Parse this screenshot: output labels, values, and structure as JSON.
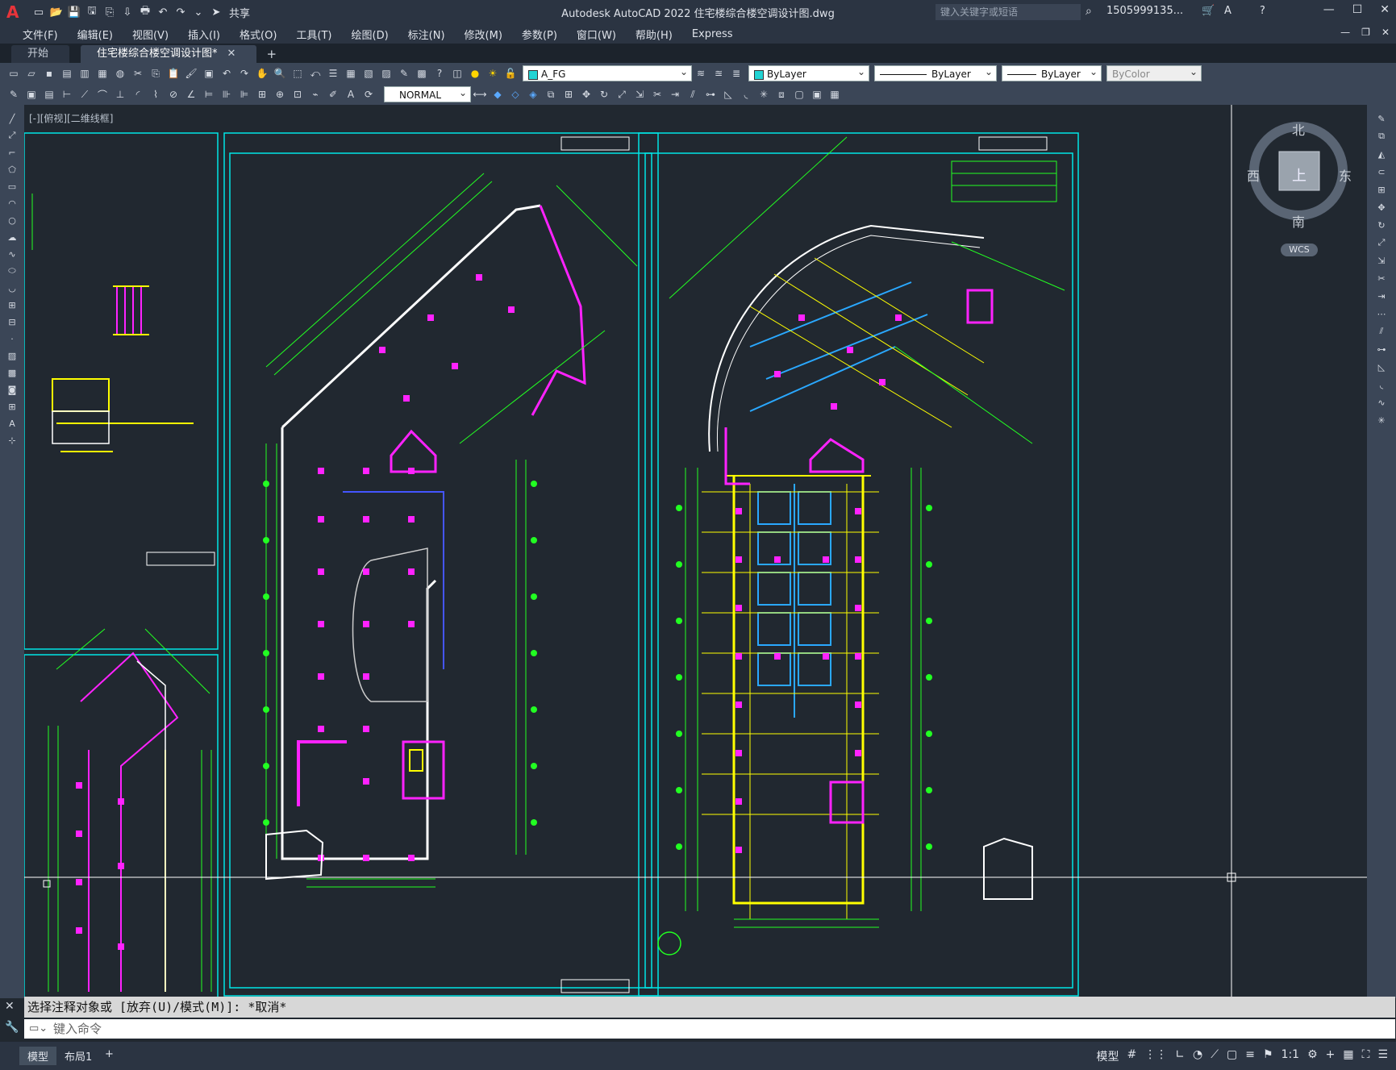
{
  "app": {
    "title": "Autodesk AutoCAD 2022    住宅楼综合楼空调设计图.dwg",
    "share_label": "共享",
    "search_placeholder": "键入关键字或短语",
    "user": "1505999135..."
  },
  "menu": [
    "文件(F)",
    "编辑(E)",
    "视图(V)",
    "插入(I)",
    "格式(O)",
    "工具(T)",
    "绘图(D)",
    "标注(N)",
    "修改(M)",
    "参数(P)",
    "窗口(W)",
    "帮助(H)",
    "Express"
  ],
  "tabs": {
    "start": "开始",
    "active": "住宅楼综合楼空调设计图*"
  },
  "toolbar": {
    "layer": "A_FG",
    "color": "ByLayer",
    "linetype": "ByLayer",
    "lineweight": "ByLayer",
    "plotstyle": "ByColor",
    "textstyle": "NORMAL",
    "layer_color": "#22d3d3"
  },
  "viewport": {
    "label": "[-][俯视][二维线框]"
  },
  "viewcube": {
    "north": "北",
    "south": "南",
    "east": "东",
    "west": "西",
    "top": "上",
    "wcs": "WCS"
  },
  "command": {
    "history": "选择注释对象或 [放弃(U)/模式(M)]: *取消*",
    "input_placeholder": "键入命令"
  },
  "status": {
    "model_tab": "模型",
    "layout_tab": "布局1",
    "model_label": "模型",
    "scale": "1:1"
  },
  "colors": {
    "frame": "#00e5e5",
    "magenta": "#ff22ff",
    "green": "#22ff22",
    "yellow": "#ffff00",
    "white": "#ffffff",
    "blue": "#2aa8ff"
  }
}
